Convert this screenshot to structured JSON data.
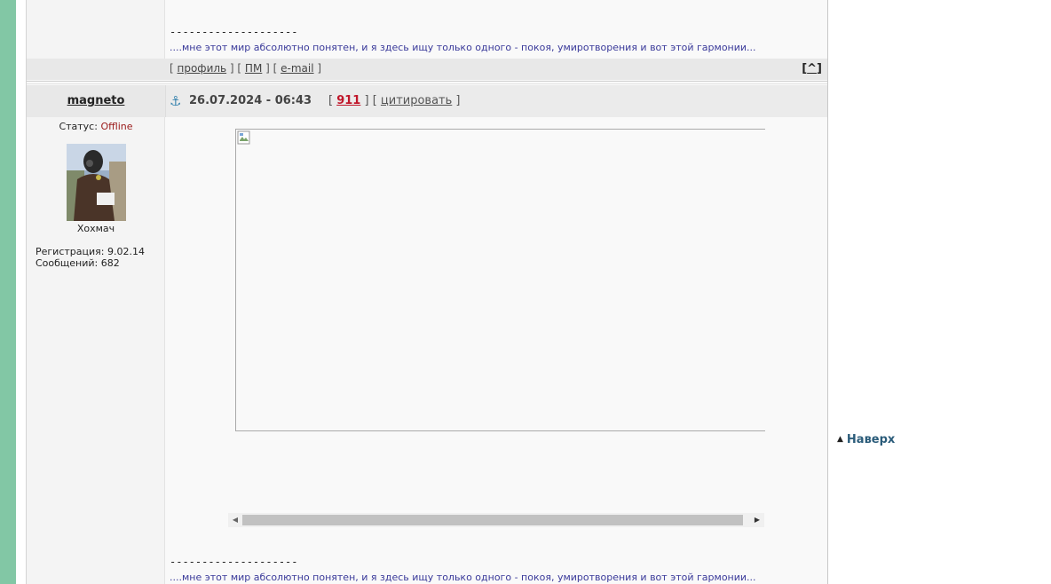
{
  "prev_post": {
    "signature_separator": "--------------------",
    "signature_text": "....мне этот мир абсолютно понятен, и я здесь ищу только одного - покоя, умиротворения и вот этой гармонии...",
    "links": {
      "profile": "профиль",
      "pm": "ПМ",
      "email": "e-mail"
    },
    "to_top": "^"
  },
  "post": {
    "username": "magneto",
    "date": "26.07.2024 - 06:43",
    "post_number": "911",
    "quote_label": "цитировать",
    "status_label": "Статус:",
    "status_value": "Offline",
    "rank": "Хохмач",
    "registration_label": "Регистрация:",
    "registration_value": "9.02.14",
    "messages_label": "Сообщений:",
    "messages_value": "682",
    "signature_separator": "--------------------",
    "signature_text": "....мне этот мир абсолютно понятен, и я здесь ищу только одного - покоя, умиротворения и вот этой гармонии..."
  },
  "nav": {
    "to_top_label": "Наверх"
  },
  "colors": {
    "left_strip": "#82c7a5",
    "status_offline": "#9a1a1a",
    "post_number": "#c0162a",
    "link_blue": "#2b5c7a"
  },
  "icons": {
    "anchor": "anchor-icon",
    "up_triangle": "up-triangle-icon",
    "broken_image": "broken-image-icon"
  }
}
